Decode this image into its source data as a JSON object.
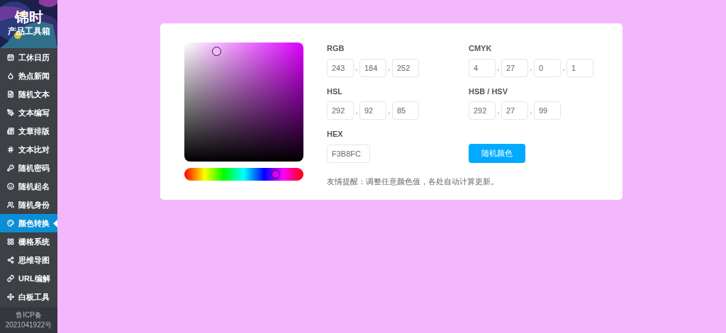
{
  "sidebar": {
    "logo_title": "锦时",
    "logo_subtitle": "产品工具箱",
    "items": [
      {
        "label": "工休日历",
        "selected": false
      },
      {
        "label": "热点新闻",
        "selected": false
      },
      {
        "label": "随机文本",
        "selected": false
      },
      {
        "label": "文本编写",
        "selected": false
      },
      {
        "label": "文章排版",
        "selected": false
      },
      {
        "label": "文本比对",
        "selected": false
      },
      {
        "label": "随机密码",
        "selected": false
      },
      {
        "label": "随机起名",
        "selected": false
      },
      {
        "label": "随机身份",
        "selected": false
      },
      {
        "label": "颜色转换",
        "selected": true
      },
      {
        "label": "栅格系统",
        "selected": false
      },
      {
        "label": "思维导图",
        "selected": false
      },
      {
        "label": "URL编解",
        "selected": false
      },
      {
        "label": "白板工具",
        "selected": false
      }
    ],
    "footer": [
      "鲁ICP备",
      "2021041922号"
    ]
  },
  "color": {
    "hue_slider": {
      "level": 0.81
    },
    "separator": ",",
    "groups": [
      {
        "label": "RGB",
        "values": [
          "243",
          "184",
          "252"
        ]
      },
      {
        "label": "CMYK",
        "values": [
          "4",
          "27",
          "0",
          "1"
        ]
      },
      {
        "label": "HSL",
        "values": [
          "292",
          "92",
          "85"
        ]
      },
      {
        "label": "HSB / HSV",
        "values": [
          "292",
          "27",
          "99"
        ]
      },
      {
        "label": "HEX",
        "values": [
          "F3B8FC"
        ]
      }
    ],
    "random_button": "随机颜色",
    "tip": "友情提醒：调整任意颜色值，各处自动计算更新。"
  }
}
